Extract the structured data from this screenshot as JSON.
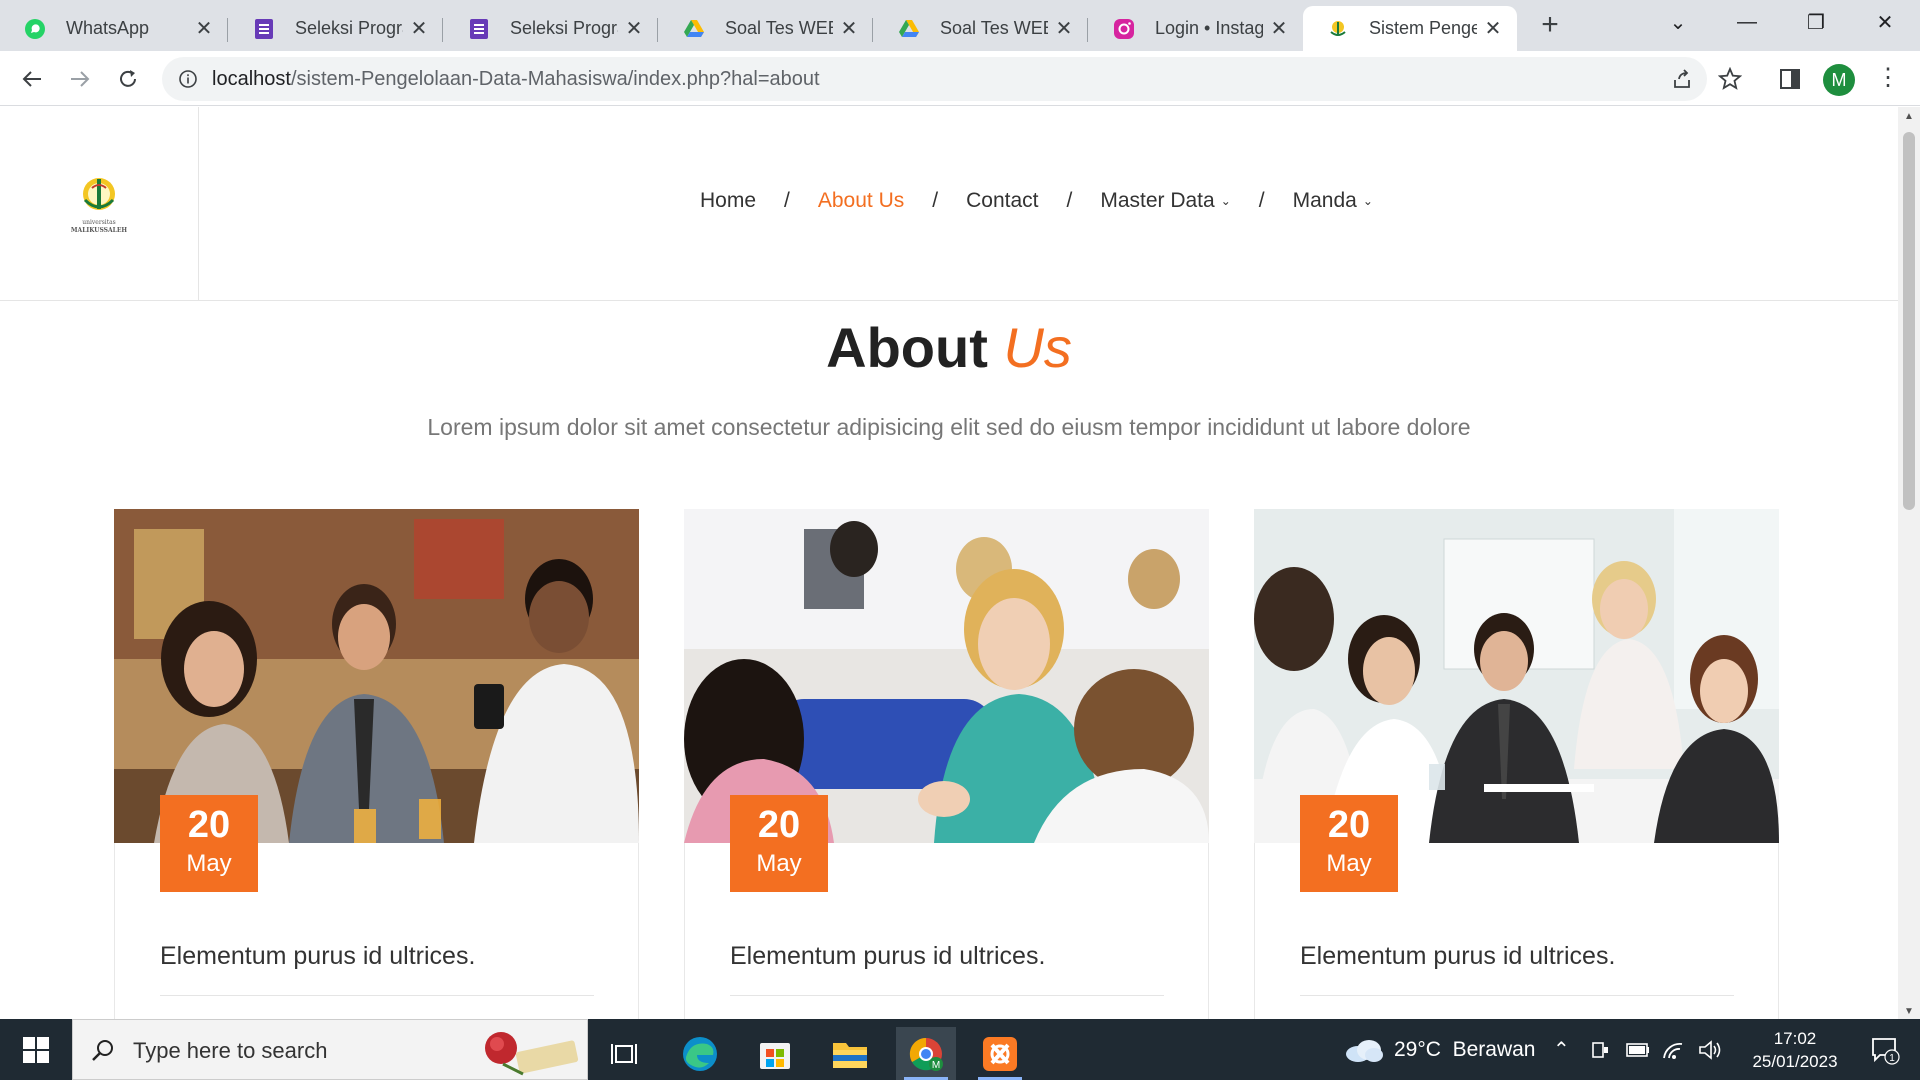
{
  "browser": {
    "tabs": [
      {
        "title": "WhatsApp",
        "icon": "whatsapp-icon"
      },
      {
        "title": "Seleksi Program",
        "icon": "forms-icon"
      },
      {
        "title": "Seleksi Program",
        "icon": "forms-icon"
      },
      {
        "title": "Soal Tes WEB D",
        "icon": "drive-icon"
      },
      {
        "title": "Soal Tes WEB D",
        "icon": "drive-icon"
      },
      {
        "title": "Login • Instagr",
        "icon": "instagram-icon"
      },
      {
        "title": "Sistem Pengelo",
        "icon": "site-icon",
        "active": true
      }
    ],
    "url_host": "localhost",
    "url_path": "/sistem-Pengelolaan-Data-Mahasiswa/index.php?hal=about",
    "profile_initial": "M"
  },
  "site": {
    "logo_text_line1": "universitas",
    "logo_text_line2": "MALIKUSSALEH",
    "nav": {
      "home": "Home",
      "about": "About Us",
      "contact": "Contact",
      "master_data": "Master Data",
      "manda": "Manda",
      "separator": "/"
    },
    "section": {
      "title_main": "About",
      "title_accent": "Us",
      "subtitle": "Lorem ipsum dolor sit amet consectetur adipisicing elit sed do eiusm tempor incididunt ut labore dolore"
    },
    "cards": [
      {
        "day": "20",
        "month": "May",
        "title": "Elementum purus id ultrices."
      },
      {
        "day": "20",
        "month": "May",
        "title": "Elementum purus id ultrices."
      },
      {
        "day": "20",
        "month": "May",
        "title": "Elementum purus id ultrices."
      }
    ],
    "accent_color": "#f36f21"
  },
  "taskbar": {
    "search_placeholder": "Type here to search",
    "weather": "29°C  Berawan",
    "time": "17:02",
    "date": "25/01/2023",
    "notifications": "1"
  }
}
